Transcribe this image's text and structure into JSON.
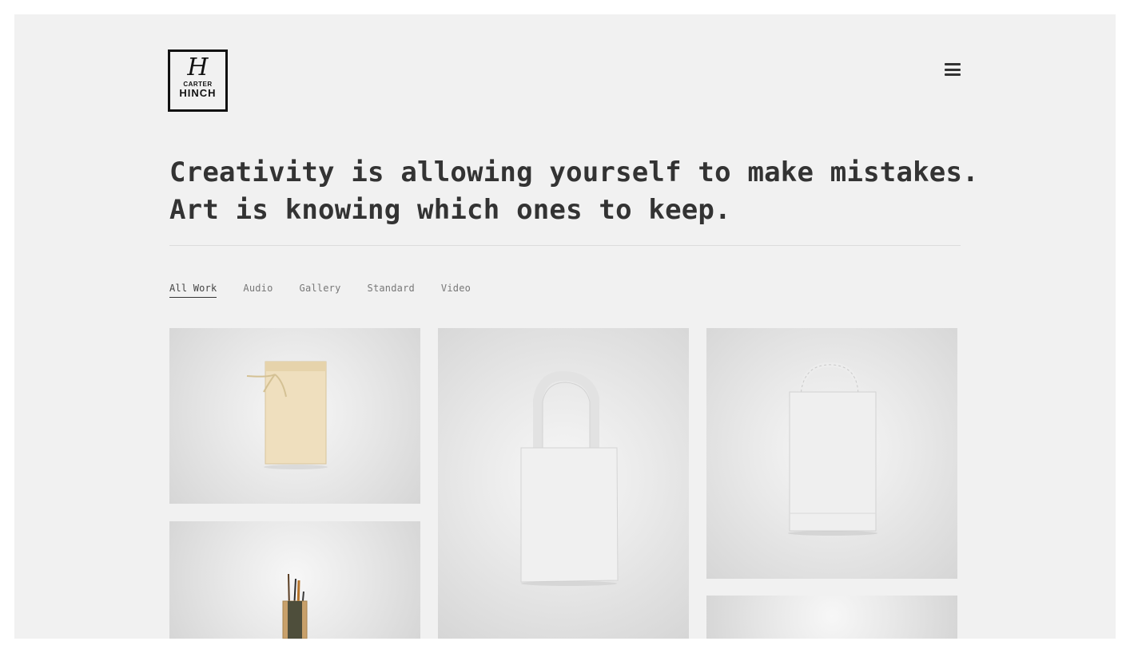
{
  "brand": {
    "mark": "H",
    "line1": "CARTER",
    "line2": "HINCH"
  },
  "header": {
    "menu_icon": "hamburger-icon"
  },
  "hero": {
    "line1": "Creativity is allowing yourself to make mistakes.",
    "line2": "Art is knowing which ones to keep."
  },
  "filters": {
    "items": [
      "All Work",
      "Audio",
      "Gallery",
      "Standard",
      "Video"
    ],
    "active": "All Work"
  },
  "portfolio": {
    "items": [
      {
        "subject": "drawstring-bag"
      },
      {
        "subject": "tote-bag"
      },
      {
        "subject": "paper-shopping-bag"
      },
      {
        "subject": "brush-holder"
      },
      {
        "subject": "blank-mockup"
      }
    ]
  },
  "colors": {
    "page_background": "#f1f1f1",
    "text": "#333333",
    "accent": "#111111"
  }
}
